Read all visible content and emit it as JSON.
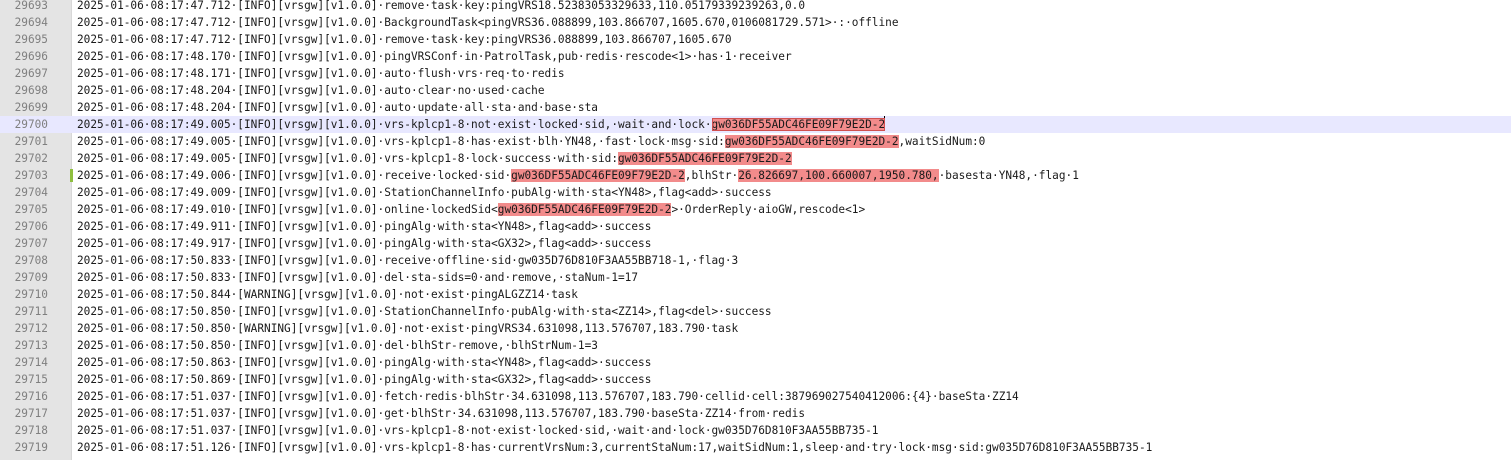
{
  "editor": {
    "current_line": "29700",
    "lines": [
      {
        "no": "29693",
        "segs": [
          {
            "t": "2025-01-06·08:17:47.712·[INFO][vrsgw][v1.0.0]·remove·task·key:pingVRS18.52383053329633,110.05179339239263,0.0"
          }
        ]
      },
      {
        "no": "29694",
        "segs": [
          {
            "t": "2025-01-06·08:17:47.712·[INFO][vrsgw][v1.0.0]·BackgroundTask<pingVRS36.088899,103.866707,1605.670,0106081729.571>·:·offline"
          }
        ]
      },
      {
        "no": "29695",
        "segs": [
          {
            "t": "2025-01-06·08:17:47.712·[INFO][vrsgw][v1.0.0]·remove·task·key:pingVRS36.088899,103.866707,1605.670"
          }
        ]
      },
      {
        "no": "29696",
        "segs": [
          {
            "t": "2025-01-06·08:17:48.170·[INFO][vrsgw][v1.0.0]·pingVRSConf·in·PatrolTask,pub·redis·rescode<1>·has·1·receiver"
          }
        ]
      },
      {
        "no": "29697",
        "segs": [
          {
            "t": "2025-01-06·08:17:48.171·[INFO][vrsgw][v1.0.0]·auto·flush·vrs·req·to·redis"
          }
        ]
      },
      {
        "no": "29698",
        "segs": [
          {
            "t": "2025-01-06·08:17:48.204·[INFO][vrsgw][v1.0.0]·auto·clear·no·used·cache"
          }
        ]
      },
      {
        "no": "29699",
        "segs": [
          {
            "t": "2025-01-06·08:17:48.204·[INFO][vrsgw][v1.0.0]·auto·update·all·sta·and·base·sta"
          }
        ]
      },
      {
        "no": "29700",
        "segs": [
          {
            "t": "2025-01-06·08:17:49.005·[INFO][vrsgw][v1.0.0]·vrs-kplcp1-8·not·exist·locked·sid,·wait·and·lock·"
          },
          {
            "t": "gw036DF55ADC46FE09F79E2D-2",
            "h": "sel"
          }
        ]
      },
      {
        "no": "29701",
        "segs": [
          {
            "t": "2025-01-06·08:17:49.005·[INFO][vrsgw][v1.0.0]·vrs-kplcp1-8·has·exist·blh·YN48,·fast·lock·msg·sid:"
          },
          {
            "t": "gw036DF55ADC46FE09F79E2D-2",
            "h": "hl"
          },
          {
            "t": ",waitSidNum:0"
          }
        ]
      },
      {
        "no": "29702",
        "segs": [
          {
            "t": "2025-01-06·08:17:49.005·[INFO][vrsgw][v1.0.0]·vrs-kplcp1-8·lock·success·with·sid:"
          },
          {
            "t": "gw036DF55ADC46FE09F79E2D-2",
            "h": "hl"
          }
        ]
      },
      {
        "no": "29703",
        "marker": true,
        "segs": [
          {
            "t": "2025-01-06·08:17:49.006·[INFO][vrsgw][v1.0.0]·receive·locked·sid·"
          },
          {
            "t": "gw036DF55ADC46FE09F79E2D-2",
            "h": "hl"
          },
          {
            "t": ",blhStr·"
          },
          {
            "t": "26.826697,100.660007,1950.780,",
            "h": "hl"
          },
          {
            "t": "·basesta·YN48,·flag·1"
          }
        ]
      },
      {
        "no": "29704",
        "segs": [
          {
            "t": "2025-01-06·08:17:49.009·[INFO][vrsgw][v1.0.0]·StationChannelInfo·pubAlg·with·sta<YN48>,flag<add>·success"
          }
        ]
      },
      {
        "no": "29705",
        "segs": [
          {
            "t": "2025-01-06·08:17:49.010·[INFO][vrsgw][v1.0.0]·online·lockedSid<"
          },
          {
            "t": "gw036DF55ADC46FE09F79E2D-2",
            "h": "hl"
          },
          {
            "t": ">·OrderReply·aioGW,rescode<1>"
          }
        ]
      },
      {
        "no": "29706",
        "segs": [
          {
            "t": "2025-01-06·08:17:49.911·[INFO][vrsgw][v1.0.0]·pingAlg·with·sta<YN48>,flag<add>·success"
          }
        ]
      },
      {
        "no": "29707",
        "segs": [
          {
            "t": "2025-01-06·08:17:49.917·[INFO][vrsgw][v1.0.0]·pingAlg·with·sta<GX32>,flag<add>·success"
          }
        ]
      },
      {
        "no": "29708",
        "segs": [
          {
            "t": "2025-01-06·08:17:50.833·[INFO][vrsgw][v1.0.0]·receive·offline·sid·gw035D76D810F3AA55BB718-1,·flag·3"
          }
        ]
      },
      {
        "no": "29709",
        "segs": [
          {
            "t": "2025-01-06·08:17:50.833·[INFO][vrsgw][v1.0.0]·del·sta-sids=0·and·remove,·staNum-1=17"
          }
        ]
      },
      {
        "no": "29710",
        "segs": [
          {
            "t": "2025-01-06·08:17:50.844·[WARNING][vrsgw][v1.0.0]·not·exist·pingALGZZ14·task"
          }
        ]
      },
      {
        "no": "29711",
        "segs": [
          {
            "t": "2025-01-06·08:17:50.850·[INFO][vrsgw][v1.0.0]·StationChannelInfo·pubAlg·with·sta<ZZ14>,flag<del>·success"
          }
        ]
      },
      {
        "no": "29712",
        "segs": [
          {
            "t": "2025-01-06·08:17:50.850·[WARNING][vrsgw][v1.0.0]·not·exist·pingVRS34.631098,113.576707,183.790·task"
          }
        ]
      },
      {
        "no": "29713",
        "segs": [
          {
            "t": "2025-01-06·08:17:50.850·[INFO][vrsgw][v1.0.0]·del·blhStr-remove,·blhStrNum-1=3"
          }
        ]
      },
      {
        "no": "29714",
        "segs": [
          {
            "t": "2025-01-06·08:17:50.863·[INFO][vrsgw][v1.0.0]·pingAlg·with·sta<YN48>,flag<add>·success"
          }
        ]
      },
      {
        "no": "29715",
        "segs": [
          {
            "t": "2025-01-06·08:17:50.869·[INFO][vrsgw][v1.0.0]·pingAlg·with·sta<GX32>,flag<add>·success"
          }
        ]
      },
      {
        "no": "29716",
        "segs": [
          {
            "t": "2025-01-06·08:17:51.037·[INFO][vrsgw][v1.0.0]·fetch·redis·blhStr·34.631098,113.576707,183.790·cellid·cell:387969027540412006:{4}·baseSta·ZZ14"
          }
        ]
      },
      {
        "no": "29717",
        "segs": [
          {
            "t": "2025-01-06·08:17:51.037·[INFO][vrsgw][v1.0.0]·get·blhStr·34.631098,113.576707,183.790·baseSta·ZZ14·from·redis"
          }
        ]
      },
      {
        "no": "29718",
        "segs": [
          {
            "t": "2025-01-06·08:17:51.037·[INFO][vrsgw][v1.0.0]·vrs-kplcp1-8·not·exist·locked·sid,·wait·and·lock·gw035D76D810F3AA55BB735-1"
          }
        ]
      },
      {
        "no": "29719",
        "segs": [
          {
            "t": "2025-01-06·08:17:51.126·[INFO][vrsgw][v1.0.0]·vrs-kplcp1-8·has·currentVrsNum:3,currentStaNum:17,waitSidNum:1,sleep·and·try·lock·msg·sid:gw035D76D810F3AA55BB735-1"
          }
        ]
      }
    ]
  }
}
